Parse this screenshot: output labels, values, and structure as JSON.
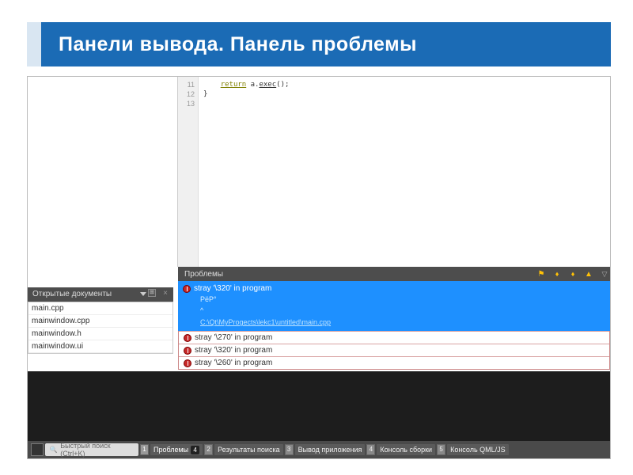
{
  "slide_title": "Панели вывода. Панель проблемы",
  "code": {
    "lines": [
      {
        "num": "11",
        "return_kw": "return",
        "rest": " a.",
        "fn": "exec",
        "tail": "();"
      },
      {
        "num": "12",
        "text": "}"
      },
      {
        "num": "13",
        "text": ""
      }
    ]
  },
  "sidebar": {
    "title": "Открытые документы",
    "items": [
      "main.cpp",
      "mainwindow.cpp",
      "mainwindow.h",
      "mainwindow.ui"
    ]
  },
  "problems": {
    "title": "Проблемы",
    "selected": {
      "message": "stray '\\320' in program",
      "detail": "РёР°",
      "caret": "^",
      "path": "C:\\Qt\\MyProgects\\lekc1\\untitled\\main.cpp"
    },
    "rows": [
      "stray '\\270' in program",
      "stray '\\320' in program",
      "stray '\\260' in program"
    ]
  },
  "status": {
    "search_placeholder": "Быстрый поиск (Ctrl+K)",
    "tabs": [
      {
        "num": "1",
        "label": "Проблемы",
        "badge": "4",
        "active": true
      },
      {
        "num": "2",
        "label": "Результаты поиска"
      },
      {
        "num": "3",
        "label": "Вывод приложения"
      },
      {
        "num": "4",
        "label": "Консоль сборки"
      },
      {
        "num": "5",
        "label": "Консоль QML/JS"
      }
    ]
  }
}
